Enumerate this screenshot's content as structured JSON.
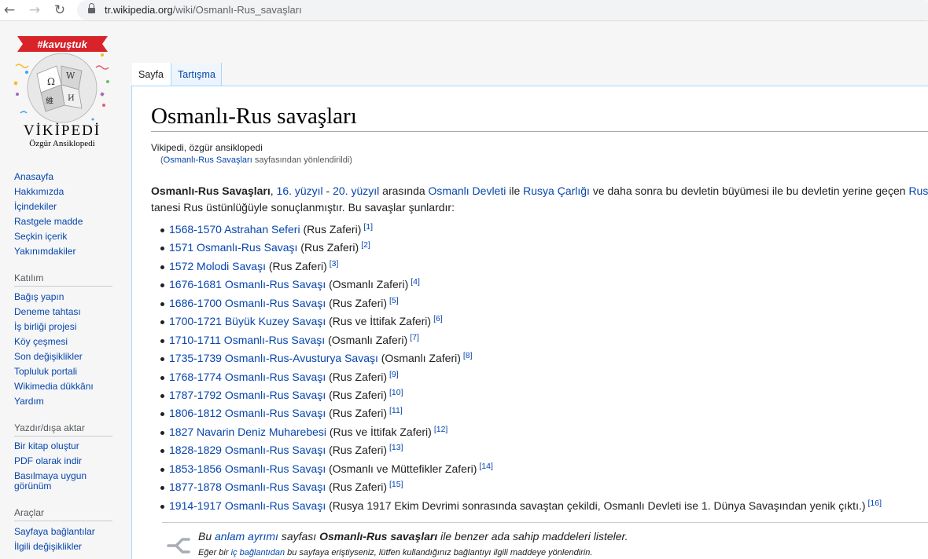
{
  "browser": {
    "url_host": "tr.wikipedia.org",
    "url_path": "/wiki/Osmanlı-Rus_savaşları"
  },
  "logo": {
    "tag": "#kavuştuk",
    "wordmark": "VİKİPEDİ",
    "subtitle": "Özgür Ansiklopedi"
  },
  "sidebar": {
    "main": [
      "Anasayfa",
      "Hakkımızda",
      "İçindekiler",
      "Rastgele madde",
      "Seçkin içerik",
      "Yakınımdakiler"
    ],
    "katilim_heading": "Katılım",
    "katilim": [
      "Bağış yapın",
      "Deneme tahtası",
      "İş birliği projesi",
      "Köy çeşmesi",
      "Son değişiklikler",
      "Topluluk portali",
      "Wikimedia dükkânı",
      "Yardım"
    ],
    "export_heading": "Yazdır/dışa aktar",
    "export": [
      "Bir kitap oluştur",
      "PDF olarak indir",
      "Basılmaya uygun",
      "görünüm"
    ],
    "tools_heading": "Araçlar",
    "tools": [
      "Sayfaya bağlantılar",
      "İlgili değişiklikler"
    ]
  },
  "tabs": {
    "page": "Sayfa",
    "talk": "Tartışma"
  },
  "article": {
    "title": "Osmanlı-Rus savaşları",
    "tagline": "Vikipedi, özgür ansiklopedi",
    "redirect_open": "(",
    "redirect_link": "Osmanlı-Rus Savaşları",
    "redirect_rest": " sayfasından yönlendirildi)",
    "intro": {
      "bold": "Osmanlı-Rus Savaşları",
      "t1": ", ",
      "l1": "16. yüzyıl",
      "t2": " - ",
      "l2": "20. yüzyıl",
      "t3": " arasında ",
      "l3": "Osmanlı Devleti",
      "t4": " ile ",
      "l4": "Rusya Çarlığı",
      "t5": " ve daha sonra bu devletin büyümesi ile bu devletin yerine geçen ",
      "l5": "Rus",
      "line2": "tanesi Rus üstünlüğüyle sonuçlanmıştır. Bu savaşlar şunlardır:"
    },
    "wars": [
      {
        "link": "1568-1570 Astrahan Seferi",
        "result": " (Rus Zaferi)",
        "ref": "[1]"
      },
      {
        "link": "1571 Osmanlı-Rus Savaşı",
        "result": " (Rus Zaferi)",
        "ref": "[2]"
      },
      {
        "link": "1572 Molodi Savaşı",
        "result": " (Rus Zaferi)",
        "ref": "[3]"
      },
      {
        "link": "1676-1681 Osmanlı-Rus Savaşı",
        "result": " (Osmanlı Zaferi)",
        "ref": "[4]"
      },
      {
        "link": "1686-1700 Osmanlı-Rus Savaşı",
        "result": " (Rus Zaferi)",
        "ref": "[5]"
      },
      {
        "link": "1700-1721 Büyük Kuzey Savaşı",
        "result": " (Rus ve İttifak Zaferi)",
        "ref": "[6]"
      },
      {
        "link": "1710-1711 Osmanlı-Rus Savaşı",
        "result": " (Osmanlı Zaferi)",
        "ref": "[7]"
      },
      {
        "link": "1735-1739 Osmanlı-Rus-Avusturya Savaşı",
        "result": " (Osmanlı Zaferi)",
        "ref": "[8]"
      },
      {
        "link": "1768-1774 Osmanlı-Rus Savaşı",
        "result": " (Rus Zaferi)",
        "ref": "[9]"
      },
      {
        "link": "1787-1792 Osmanlı-Rus Savaşı",
        "result": " (Rus Zaferi)",
        "ref": "[10]"
      },
      {
        "link": "1806-1812 Osmanlı-Rus Savaşı",
        "result": " (Rus Zaferi)",
        "ref": "[11]"
      },
      {
        "link": "1827 Navarin Deniz Muharebesi",
        "result": " (Rus ve İttifak Zaferi)",
        "ref": "[12]"
      },
      {
        "link": "1828-1829 Osmanlı-Rus Savaşı",
        "result": " (Rus Zaferi)",
        "ref": "[13]"
      },
      {
        "link": "1853-1856 Osmanlı-Rus Savaşı",
        "result": " (Osmanlı ve Müttefikler Zaferi)",
        "ref": "[14]"
      },
      {
        "link": "1877-1878 Osmanlı-Rus Savaşı",
        "result": " (Rus Zaferi)",
        "ref": "[15]"
      },
      {
        "link": "1914-1917 Osmanlı-Rus Savaşı",
        "result": " (Rusya 1917 Ekim Devrimi sonrasında savaştan çekildi, Osmanlı Devleti ise 1. Dünya Savaşından yenik çıktı.)",
        "ref": "[16]"
      }
    ],
    "hatnote": {
      "t1": "Bu ",
      "link": "anlam ayrımı",
      "t2": " sayfası ",
      "bold": "Osmanlı-Rus savaşları",
      "t3": " ile benzer ada sahip maddeleri listeler.",
      "s1": "Eğer bir ",
      "slink": "iç bağlantıdan",
      "s2": " bu sayfaya eriştiyseniz, lütfen kullandığınız bağlantıyı ilgili maddeye yönlendirin."
    }
  }
}
